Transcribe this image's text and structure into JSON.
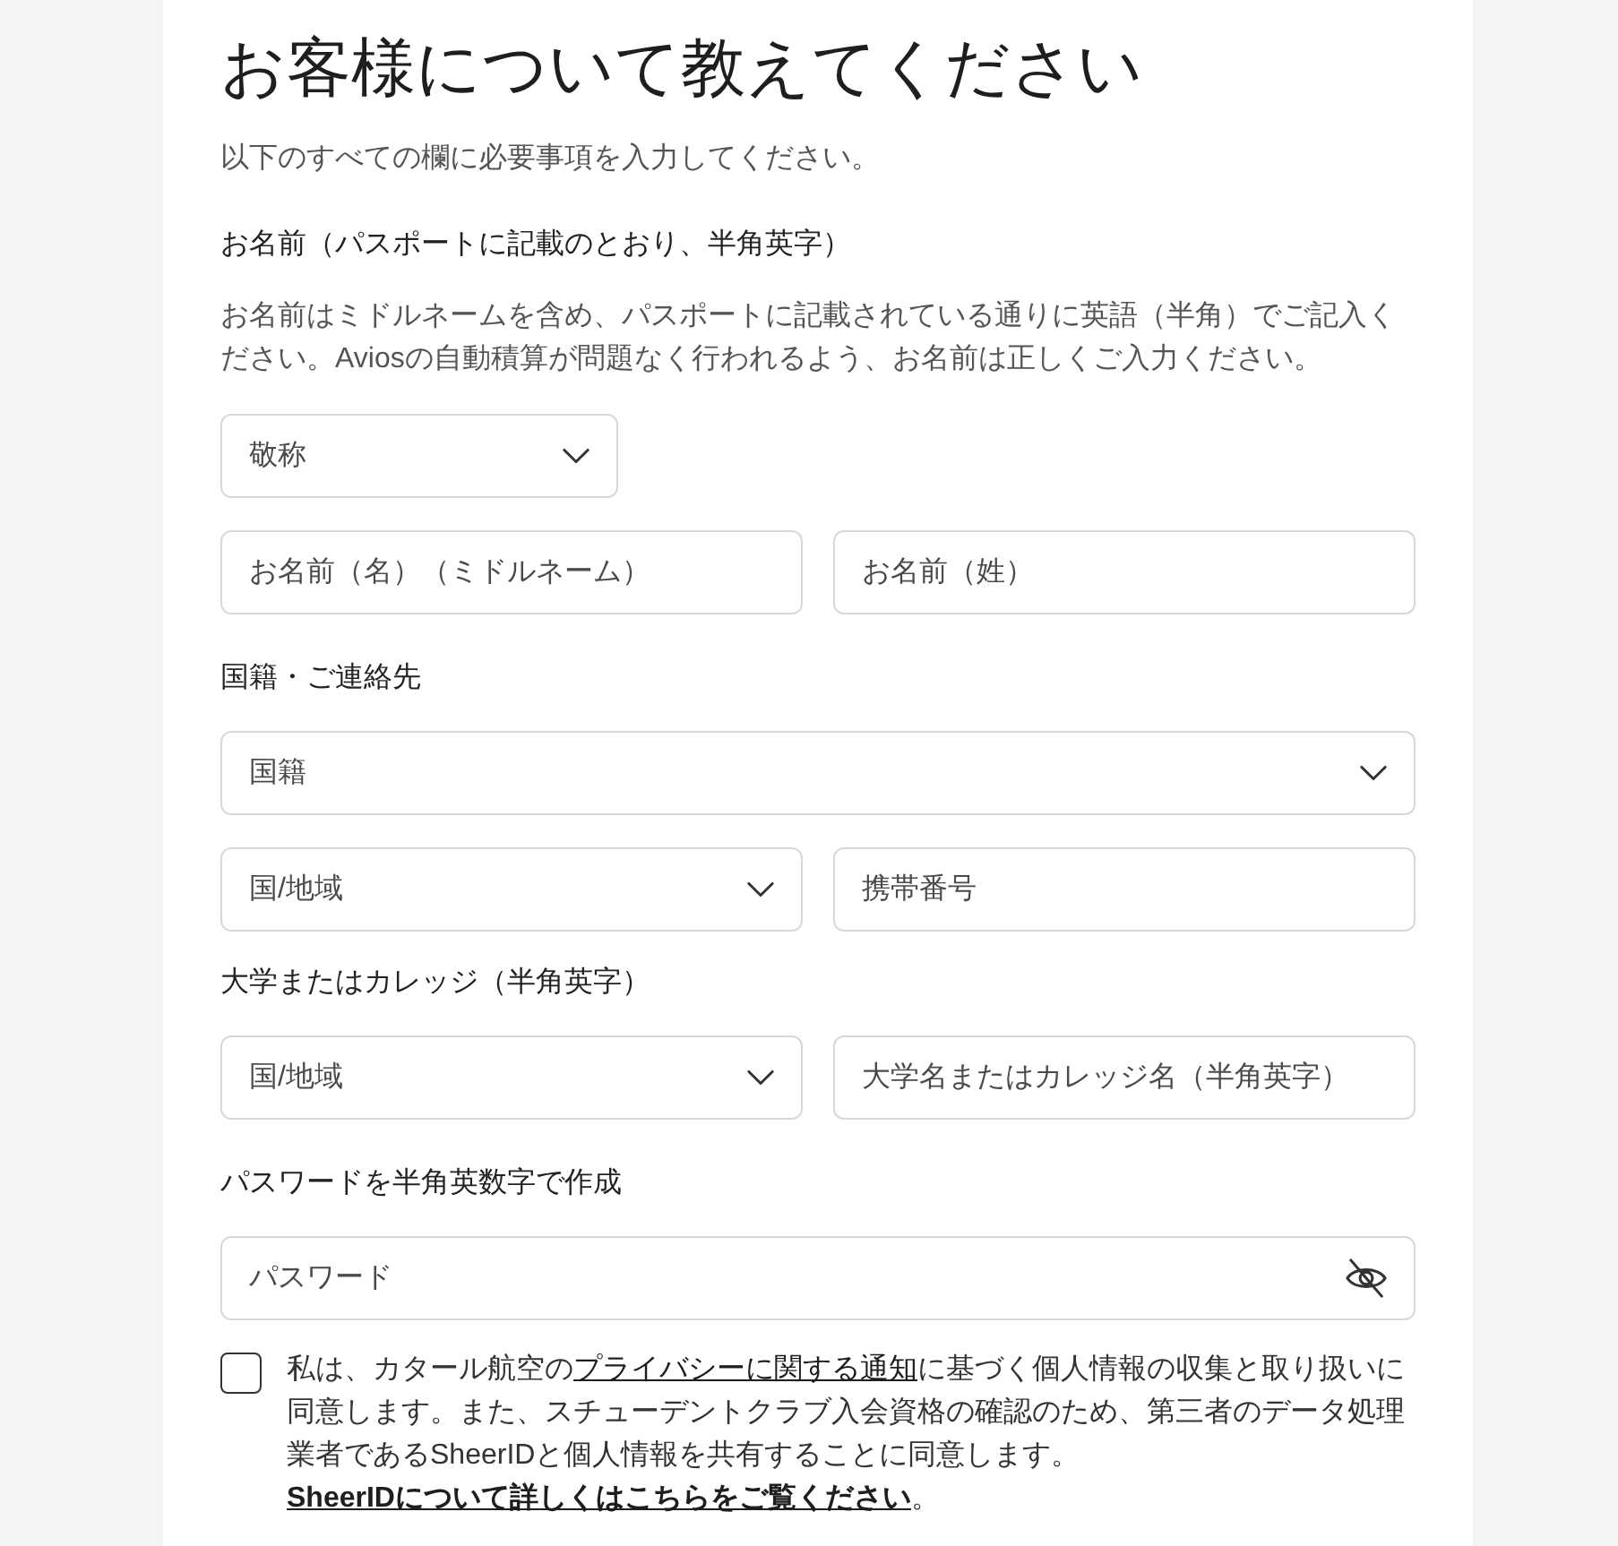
{
  "heading": "お客様について教えてください",
  "intro": "以下のすべての欄に必要事項を入力してください。",
  "sections": [
    {
      "label": "お名前（パスポートに記載のとおり、半角英字）",
      "note": "お名前はミドルネームを含め、パスポートに記載されている通りに英語（半角）でご記入ください。Aviosの自動積算が問題なく行われるよう、お名前は正しくご入力ください。",
      "rows": [
        [
          {
            "kind": "compact-select",
            "placeholder": "敬称"
          }
        ],
        [
          {
            "kind": "input",
            "placeholder": "お名前（名）（ミドルネーム）"
          },
          {
            "kind": "input",
            "placeholder": "お名前（姓）"
          }
        ]
      ]
    },
    {
      "label": "国籍・ご連絡先",
      "rows": [
        [
          {
            "kind": "select",
            "placeholder": "国籍"
          }
        ],
        [
          {
            "kind": "select",
            "placeholder": "国/地域"
          },
          {
            "kind": "input",
            "placeholder": "携帯番号"
          }
        ]
      ]
    },
    {
      "label": "大学またはカレッジ（半角英字）",
      "rows": [
        [
          {
            "kind": "select",
            "placeholder": "国/地域"
          },
          {
            "kind": "input",
            "placeholder": "大学名またはカレッジ名（半角英字）"
          }
        ]
      ]
    },
    {
      "label": "パスワードを半角英数字で作成",
      "rows": [
        [
          {
            "kind": "password",
            "placeholder": "パスワード"
          }
        ]
      ]
    }
  ],
  "consent": {
    "checked": false,
    "segments": [
      {
        "kind": "text",
        "text": "私は、カタール航空の"
      },
      {
        "kind": "link",
        "text": "プライバシーに関する通知",
        "strong": false
      },
      {
        "kind": "text",
        "text": "に基づく個人情報の収集と取り扱いに同意します。また、スチューデントクラブ入会資格の確認のため、第三者のデータ処理業者であるSheerIDと個人情報を共有することに同意します。"
      },
      {
        "kind": "link",
        "text": "SheerIDについて詳しくはこちらをご覧ください",
        "strong": true
      },
      {
        "kind": "text",
        "text": "。"
      }
    ]
  }
}
